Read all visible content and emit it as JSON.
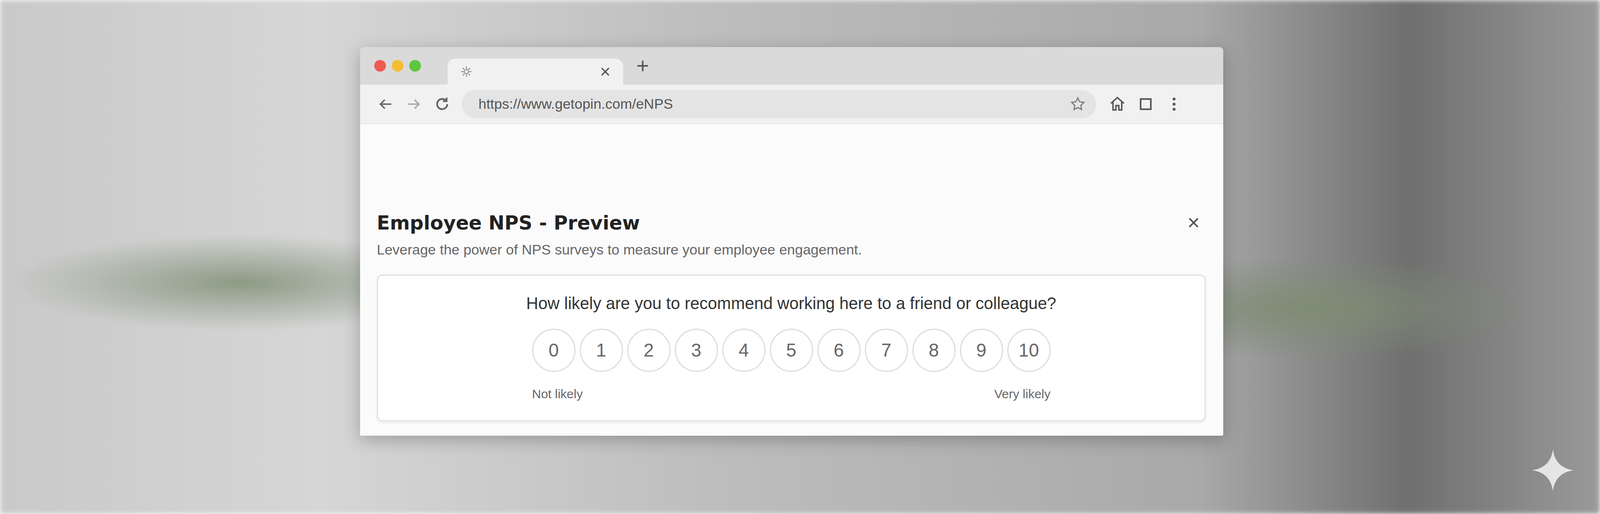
{
  "browser": {
    "tab": {
      "close": "×"
    },
    "new_tab": "+",
    "url": "https://www.getopin.com/eNPS"
  },
  "dialog": {
    "title": "Employee NPS - Preview",
    "subtitle": "Leverage the power of NPS surveys to measure your employee engagement.",
    "close": "×"
  },
  "survey": {
    "question": "How likely are you to recommend working here to a friend or colleague?",
    "options": [
      {
        "label": "0",
        "selected": false
      },
      {
        "label": "1",
        "selected": false
      },
      {
        "label": "2",
        "selected": false
      },
      {
        "label": "3",
        "selected": false
      },
      {
        "label": "4",
        "selected": false
      },
      {
        "label": "5",
        "selected": false
      },
      {
        "label": "6",
        "selected": false
      },
      {
        "label": "7",
        "selected": false
      },
      {
        "label": "8",
        "selected": false
      },
      {
        "label": "9",
        "selected": false
      },
      {
        "label": "10",
        "selected": false
      }
    ],
    "low_label": "Not likely",
    "high_label": "Very likely"
  }
}
